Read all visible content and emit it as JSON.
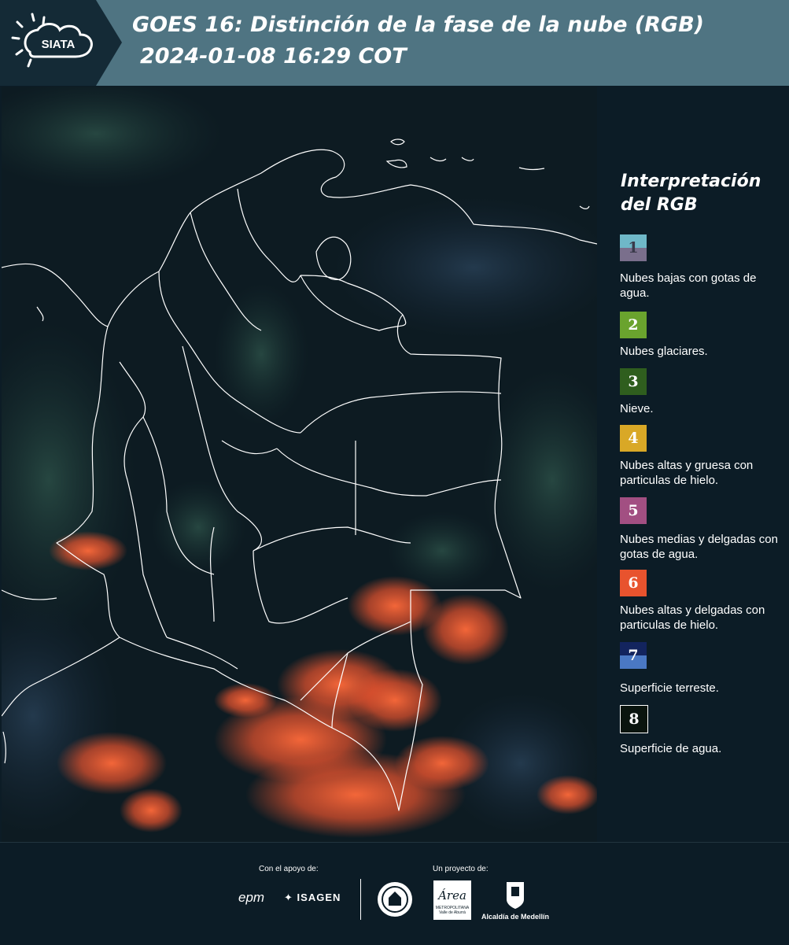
{
  "header": {
    "logo_text": "SIATA",
    "title_line1": "GOES 16: Distinción de la fase de la nube (RGB)",
    "title_line2": "2024-01-08 16:29 COT"
  },
  "legend": {
    "title": "Interpretación del RGB",
    "items": [
      {
        "number": "1",
        "label": "Nubes bajas con gotas de agua.",
        "color_top": "#6fb8c8",
        "color_bottom": "#7a6f8c"
      },
      {
        "number": "2",
        "label": "Nubes glaciares.",
        "color_top": "#6aa32e",
        "color_bottom": "#6aa32e"
      },
      {
        "number": "3",
        "label": "Nieve.",
        "color_top": "#2f5e1e",
        "color_bottom": "#2f5e1e"
      },
      {
        "number": "4",
        "label": "Nubes altas y gruesa con particulas de hielo.",
        "color_top": "#d9a826",
        "color_bottom": "#d9a826"
      },
      {
        "number": "5",
        "label": "Nubes medias y delgadas con gotas de agua.",
        "color_top": "#a24f82",
        "color_bottom": "#a24f82"
      },
      {
        "number": "6",
        "label": "Nubes altas y delgadas con particulas de hielo.",
        "color_top": "#e8532e",
        "color_bottom": "#e8532e"
      },
      {
        "number": "7",
        "label": "Superficie terreste.",
        "color_top": "#13245e",
        "color_bottom": "#4a78c4"
      },
      {
        "number": "8",
        "label": "Superficie de agua.",
        "color_top": "#0a140e",
        "color_bottom": "#0a140e"
      }
    ]
  },
  "footer": {
    "support_label": "Con el apoyo de:",
    "project_label": "Un proyecto de:",
    "sponsor_epm": "epm",
    "sponsor_isagen": "ISAGEN",
    "area_name": "Área",
    "area_sub1": "METROPOLITANA",
    "area_sub2": "Valle de Aburrá",
    "alcaldia": "Alcaldía de Medellín"
  }
}
